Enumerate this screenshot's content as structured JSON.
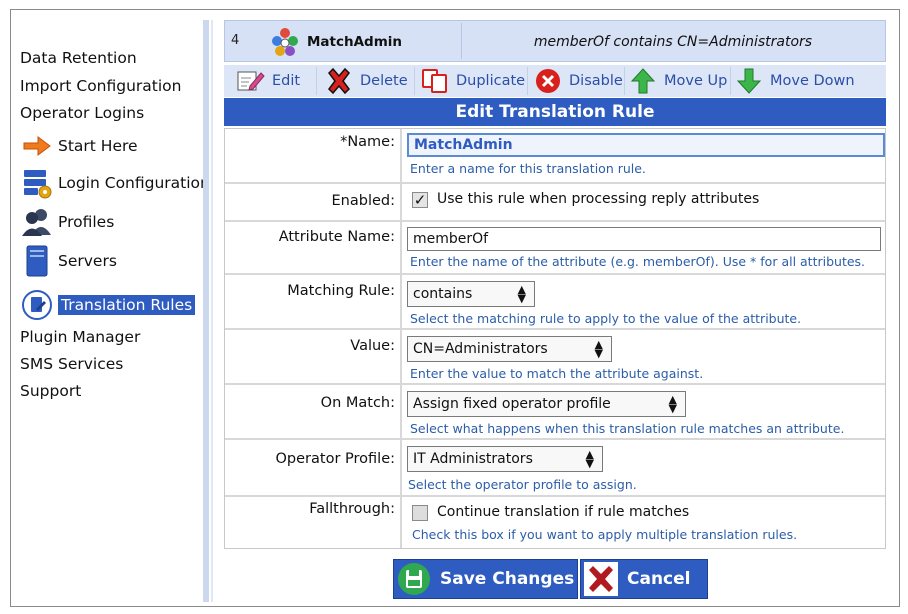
{
  "sidebar": {
    "items": [
      {
        "label": "Data Retention",
        "icon": "none"
      },
      {
        "label": "Import Configuration",
        "icon": "none"
      },
      {
        "label": "Operator Logins",
        "icon": "none"
      },
      {
        "label": "Start Here",
        "icon": "arrow-right-icon"
      },
      {
        "label": "Login Configuration",
        "icon": "server-gear-icon"
      },
      {
        "label": "Profiles",
        "icon": "users-icon"
      },
      {
        "label": "Servers",
        "icon": "server-icon"
      },
      {
        "label": "Translation Rules",
        "icon": "translation-rules-icon",
        "active": true
      },
      {
        "label": "Plugin Manager",
        "icon": "none"
      },
      {
        "label": "SMS Services",
        "icon": "none"
      },
      {
        "label": "Support",
        "icon": "none"
      }
    ]
  },
  "rule": {
    "number": "4",
    "name": "MatchAdmin",
    "description": "memberOf contains CN=Administrators"
  },
  "toolbar": {
    "edit": "Edit",
    "delete": "Delete",
    "duplicate": "Duplicate",
    "disable": "Disable",
    "move_up": "Move Up",
    "move_down": "Move Down"
  },
  "form": {
    "title": "Edit Translation Rule",
    "name": {
      "label": "*Name:",
      "value": "MatchAdmin",
      "hint": "Enter a name for this translation rule."
    },
    "enabled": {
      "label": "Enabled:",
      "checked": true,
      "text": "Use this rule when processing reply attributes"
    },
    "attribute_name": {
      "label": "Attribute Name:",
      "value": "memberOf",
      "hint": "Enter the name of the attribute (e.g. memberOf). Use * for all attributes."
    },
    "matching_rule": {
      "label": "Matching Rule:",
      "value": "contains",
      "hint": "Select the matching rule to apply to the value of the attribute."
    },
    "value": {
      "label": "Value:",
      "value": "CN=Administrators",
      "hint": "Enter the value to match the attribute against."
    },
    "on_match": {
      "label": "On Match:",
      "value": "Assign fixed operator profile",
      "hint": "Select what happens when this translation rule matches an attribute."
    },
    "operator_profile": {
      "label": "Operator Profile:",
      "value": "IT Administrators",
      "hint": "Select the operator profile to assign."
    },
    "fallthrough": {
      "label": "Fallthrough:",
      "checked": false,
      "text": "Continue translation if rule matches",
      "hint": "Check this box if you want to apply multiple translation rules."
    }
  },
  "buttons": {
    "save": "Save Changes",
    "cancel": "Cancel"
  },
  "colors": {
    "accent": "#2f5cc0",
    "hint": "#2b5da8",
    "header_bg": "#d6e1f5"
  }
}
